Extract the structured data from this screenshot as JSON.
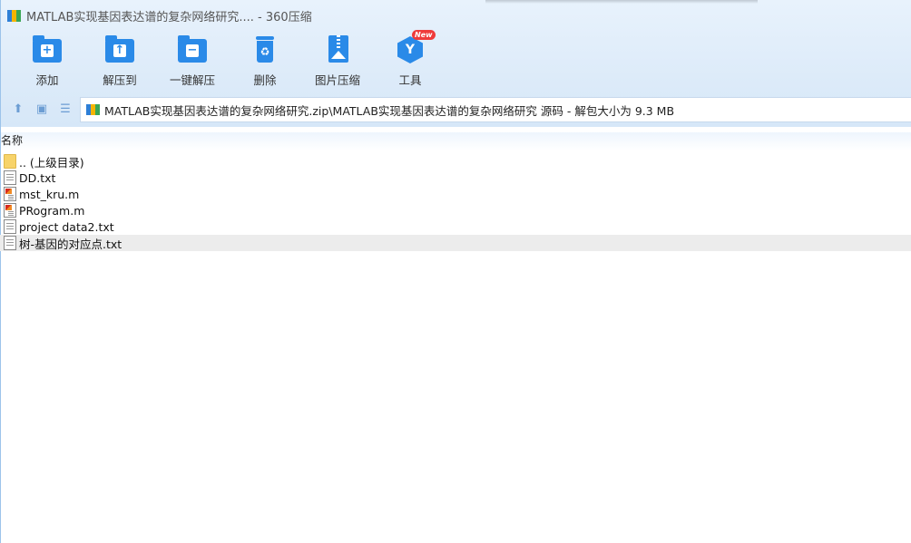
{
  "window": {
    "title": "MATLAB实现基因表达谱的复杂网络研究.... - 360压缩"
  },
  "toolbar": {
    "items": [
      {
        "label": "添加",
        "icon": "add-folder-icon"
      },
      {
        "label": "解压到",
        "icon": "extract-to-icon"
      },
      {
        "label": "一键解压",
        "icon": "one-click-extract-icon"
      },
      {
        "label": "删除",
        "icon": "trash-icon"
      },
      {
        "label": "图片压缩",
        "icon": "image-compress-icon"
      },
      {
        "label": "工具",
        "icon": "tools-icon",
        "badge": "New"
      }
    ]
  },
  "address": {
    "path": "MATLAB实现基因表达谱的复杂网络研究.zip\\MATLAB实现基因表达谱的复杂网络研究 源码 - 解包大小为 9.3 MB"
  },
  "list": {
    "header_name": "名称",
    "files": [
      {
        "name": ".. (上级目录)",
        "type": "folder"
      },
      {
        "name": "DD.txt",
        "type": "text"
      },
      {
        "name": "mst_kru.m",
        "type": "matlab"
      },
      {
        "name": "PRogram.m",
        "type": "matlab"
      },
      {
        "name": "project data2.txt",
        "type": "text"
      },
      {
        "name": "树-基因的对应点.txt",
        "type": "text",
        "selected": true
      }
    ]
  },
  "colors": {
    "accent": "#2a8ae8",
    "badge": "#ef3b3b",
    "selected_row": "#ececec"
  }
}
